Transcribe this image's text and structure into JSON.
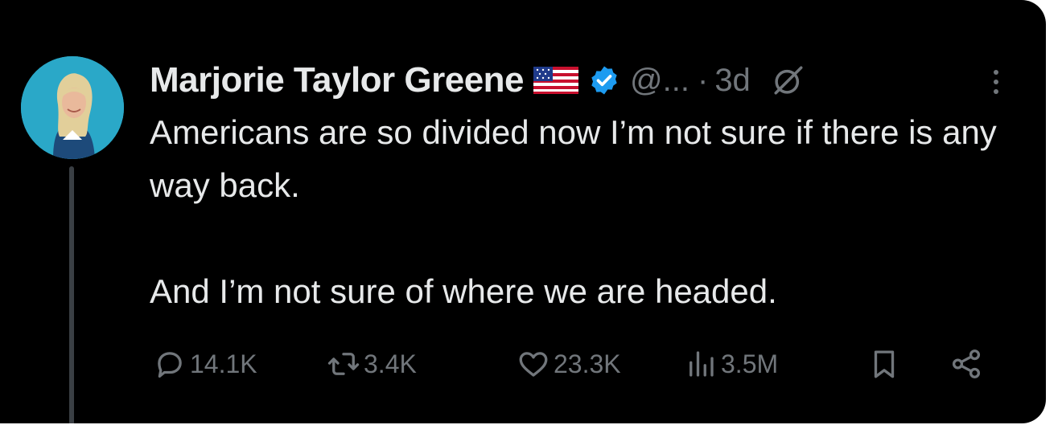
{
  "tweet": {
    "author_name": "Marjorie Taylor Greene",
    "handle": "@...",
    "separator": "·",
    "time": "3d",
    "text_line_1": "Americans are so divided now I’m not sure if there is any way back.",
    "text_line_2": "And I’m not sure of where we are headed."
  },
  "actions": {
    "replies": "14.1K",
    "reposts": "3.4K",
    "likes": "23.3K",
    "views": "3.5M"
  },
  "icons": {
    "flag": "us-flag-emoji",
    "verified": "verified-badge-icon",
    "grok": "grok-icon",
    "more": "more-options-icon",
    "reply": "reply-icon",
    "repost": "repost-icon",
    "like": "heart-icon",
    "views": "views-icon",
    "bookmark": "bookmark-icon",
    "share": "share-icon"
  },
  "colors": {
    "background": "#000000",
    "text_primary": "#e7e9ea",
    "text_secondary": "#71767b",
    "verified_blue": "#1d9bf0"
  }
}
